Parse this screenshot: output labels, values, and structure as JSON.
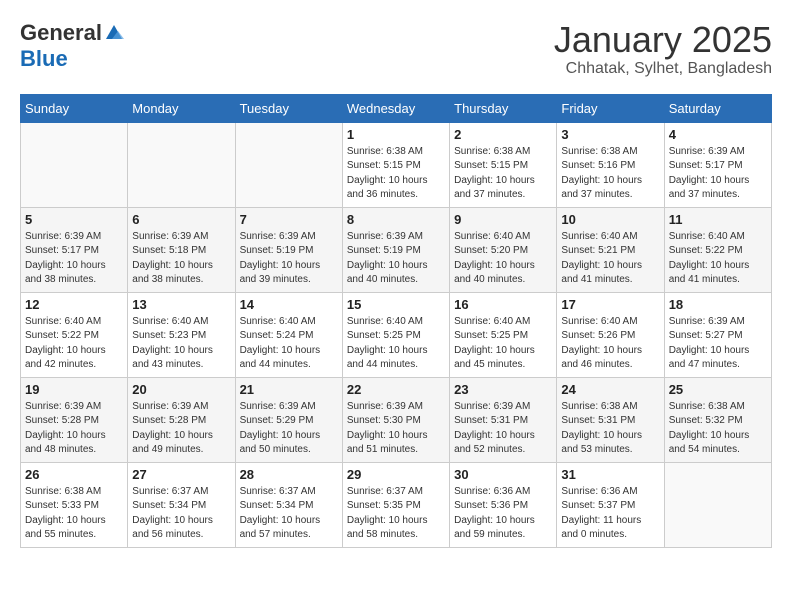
{
  "header": {
    "logo": {
      "general": "General",
      "blue": "Blue"
    },
    "title": "January 2025",
    "subtitle": "Chhatak, Sylhet, Bangladesh"
  },
  "weekdays": [
    "Sunday",
    "Monday",
    "Tuesday",
    "Wednesday",
    "Thursday",
    "Friday",
    "Saturday"
  ],
  "weeks": [
    [
      {
        "day": "",
        "sunrise": "",
        "sunset": "",
        "daylight": ""
      },
      {
        "day": "",
        "sunrise": "",
        "sunset": "",
        "daylight": ""
      },
      {
        "day": "",
        "sunrise": "",
        "sunset": "",
        "daylight": ""
      },
      {
        "day": "1",
        "sunrise": "Sunrise: 6:38 AM",
        "sunset": "Sunset: 5:15 PM",
        "daylight": "Daylight: 10 hours and 36 minutes."
      },
      {
        "day": "2",
        "sunrise": "Sunrise: 6:38 AM",
        "sunset": "Sunset: 5:15 PM",
        "daylight": "Daylight: 10 hours and 37 minutes."
      },
      {
        "day": "3",
        "sunrise": "Sunrise: 6:38 AM",
        "sunset": "Sunset: 5:16 PM",
        "daylight": "Daylight: 10 hours and 37 minutes."
      },
      {
        "day": "4",
        "sunrise": "Sunrise: 6:39 AM",
        "sunset": "Sunset: 5:17 PM",
        "daylight": "Daylight: 10 hours and 37 minutes."
      }
    ],
    [
      {
        "day": "5",
        "sunrise": "Sunrise: 6:39 AM",
        "sunset": "Sunset: 5:17 PM",
        "daylight": "Daylight: 10 hours and 38 minutes."
      },
      {
        "day": "6",
        "sunrise": "Sunrise: 6:39 AM",
        "sunset": "Sunset: 5:18 PM",
        "daylight": "Daylight: 10 hours and 38 minutes."
      },
      {
        "day": "7",
        "sunrise": "Sunrise: 6:39 AM",
        "sunset": "Sunset: 5:19 PM",
        "daylight": "Daylight: 10 hours and 39 minutes."
      },
      {
        "day": "8",
        "sunrise": "Sunrise: 6:39 AM",
        "sunset": "Sunset: 5:19 PM",
        "daylight": "Daylight: 10 hours and 40 minutes."
      },
      {
        "day": "9",
        "sunrise": "Sunrise: 6:40 AM",
        "sunset": "Sunset: 5:20 PM",
        "daylight": "Daylight: 10 hours and 40 minutes."
      },
      {
        "day": "10",
        "sunrise": "Sunrise: 6:40 AM",
        "sunset": "Sunset: 5:21 PM",
        "daylight": "Daylight: 10 hours and 41 minutes."
      },
      {
        "day": "11",
        "sunrise": "Sunrise: 6:40 AM",
        "sunset": "Sunset: 5:22 PM",
        "daylight": "Daylight: 10 hours and 41 minutes."
      }
    ],
    [
      {
        "day": "12",
        "sunrise": "Sunrise: 6:40 AM",
        "sunset": "Sunset: 5:22 PM",
        "daylight": "Daylight: 10 hours and 42 minutes."
      },
      {
        "day": "13",
        "sunrise": "Sunrise: 6:40 AM",
        "sunset": "Sunset: 5:23 PM",
        "daylight": "Daylight: 10 hours and 43 minutes."
      },
      {
        "day": "14",
        "sunrise": "Sunrise: 6:40 AM",
        "sunset": "Sunset: 5:24 PM",
        "daylight": "Daylight: 10 hours and 44 minutes."
      },
      {
        "day": "15",
        "sunrise": "Sunrise: 6:40 AM",
        "sunset": "Sunset: 5:25 PM",
        "daylight": "Daylight: 10 hours and 44 minutes."
      },
      {
        "day": "16",
        "sunrise": "Sunrise: 6:40 AM",
        "sunset": "Sunset: 5:25 PM",
        "daylight": "Daylight: 10 hours and 45 minutes."
      },
      {
        "day": "17",
        "sunrise": "Sunrise: 6:40 AM",
        "sunset": "Sunset: 5:26 PM",
        "daylight": "Daylight: 10 hours and 46 minutes."
      },
      {
        "day": "18",
        "sunrise": "Sunrise: 6:39 AM",
        "sunset": "Sunset: 5:27 PM",
        "daylight": "Daylight: 10 hours and 47 minutes."
      }
    ],
    [
      {
        "day": "19",
        "sunrise": "Sunrise: 6:39 AM",
        "sunset": "Sunset: 5:28 PM",
        "daylight": "Daylight: 10 hours and 48 minutes."
      },
      {
        "day": "20",
        "sunrise": "Sunrise: 6:39 AM",
        "sunset": "Sunset: 5:28 PM",
        "daylight": "Daylight: 10 hours and 49 minutes."
      },
      {
        "day": "21",
        "sunrise": "Sunrise: 6:39 AM",
        "sunset": "Sunset: 5:29 PM",
        "daylight": "Daylight: 10 hours and 50 minutes."
      },
      {
        "day": "22",
        "sunrise": "Sunrise: 6:39 AM",
        "sunset": "Sunset: 5:30 PM",
        "daylight": "Daylight: 10 hours and 51 minutes."
      },
      {
        "day": "23",
        "sunrise": "Sunrise: 6:39 AM",
        "sunset": "Sunset: 5:31 PM",
        "daylight": "Daylight: 10 hours and 52 minutes."
      },
      {
        "day": "24",
        "sunrise": "Sunrise: 6:38 AM",
        "sunset": "Sunset: 5:31 PM",
        "daylight": "Daylight: 10 hours and 53 minutes."
      },
      {
        "day": "25",
        "sunrise": "Sunrise: 6:38 AM",
        "sunset": "Sunset: 5:32 PM",
        "daylight": "Daylight: 10 hours and 54 minutes."
      }
    ],
    [
      {
        "day": "26",
        "sunrise": "Sunrise: 6:38 AM",
        "sunset": "Sunset: 5:33 PM",
        "daylight": "Daylight: 10 hours and 55 minutes."
      },
      {
        "day": "27",
        "sunrise": "Sunrise: 6:37 AM",
        "sunset": "Sunset: 5:34 PM",
        "daylight": "Daylight: 10 hours and 56 minutes."
      },
      {
        "day": "28",
        "sunrise": "Sunrise: 6:37 AM",
        "sunset": "Sunset: 5:34 PM",
        "daylight": "Daylight: 10 hours and 57 minutes."
      },
      {
        "day": "29",
        "sunrise": "Sunrise: 6:37 AM",
        "sunset": "Sunset: 5:35 PM",
        "daylight": "Daylight: 10 hours and 58 minutes."
      },
      {
        "day": "30",
        "sunrise": "Sunrise: 6:36 AM",
        "sunset": "Sunset: 5:36 PM",
        "daylight": "Daylight: 10 hours and 59 minutes."
      },
      {
        "day": "31",
        "sunrise": "Sunrise: 6:36 AM",
        "sunset": "Sunset: 5:37 PM",
        "daylight": "Daylight: 11 hours and 0 minutes."
      },
      {
        "day": "",
        "sunrise": "",
        "sunset": "",
        "daylight": ""
      }
    ]
  ]
}
